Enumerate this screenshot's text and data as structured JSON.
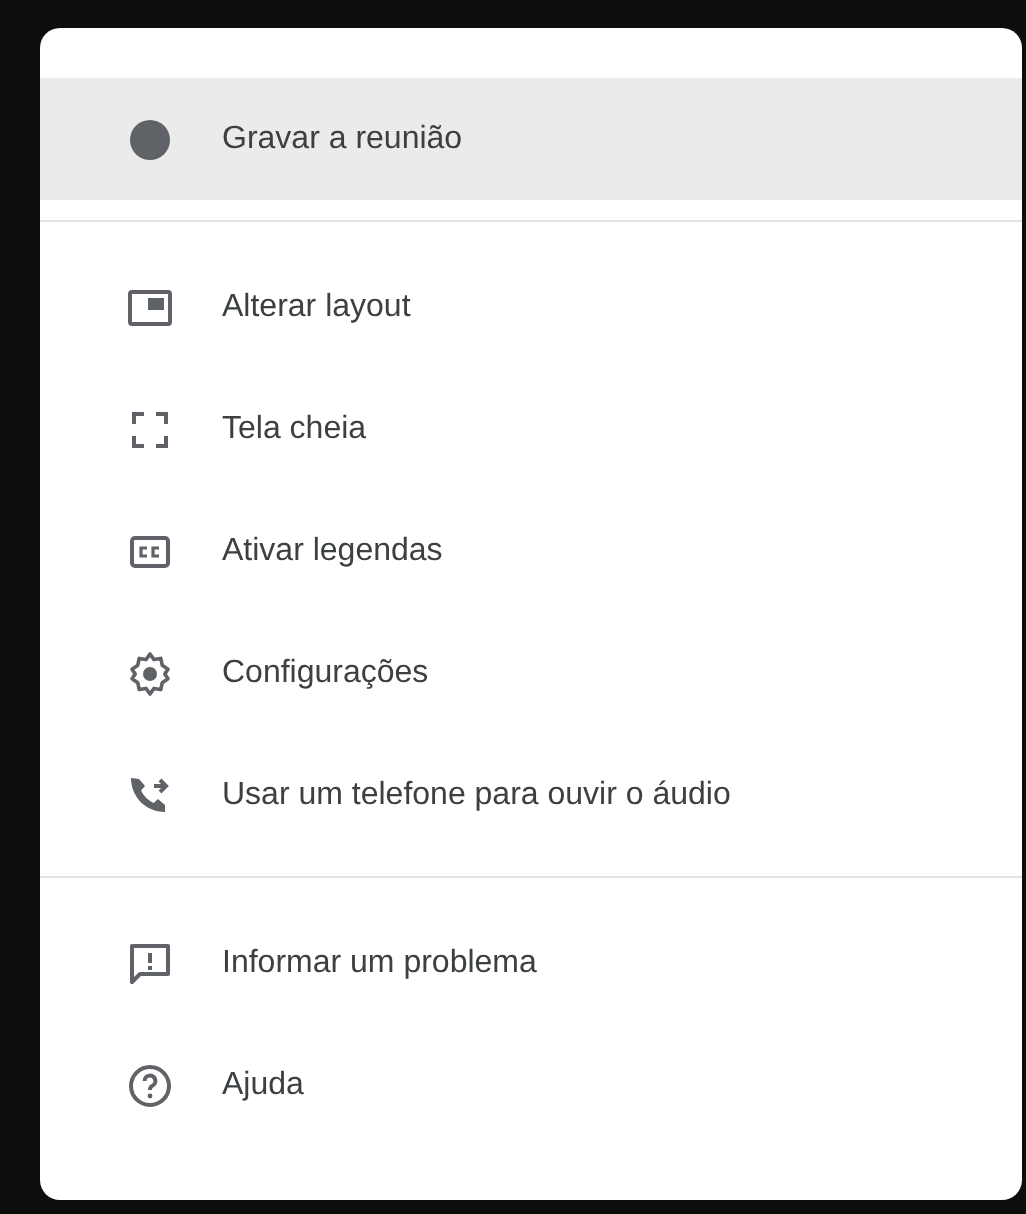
{
  "menu": {
    "sections": [
      {
        "items": [
          {
            "label": "Gravar a reunião",
            "kind": "record",
            "selected": true
          }
        ]
      },
      {
        "items": [
          {
            "label": "Alterar layout",
            "kind": "layout",
            "selected": false
          },
          {
            "label": "Tela cheia",
            "kind": "fullscreen",
            "selected": false
          },
          {
            "label": "Ativar legendas",
            "kind": "captions",
            "selected": false
          },
          {
            "label": "Configurações",
            "kind": "settings",
            "selected": false
          },
          {
            "label": "Usar um telefone para ouvir o áudio",
            "kind": "phone",
            "selected": false
          }
        ]
      },
      {
        "items": [
          {
            "label": "Informar um problema",
            "kind": "feedback",
            "selected": false
          },
          {
            "label": "Ajuda",
            "kind": "help",
            "selected": false
          }
        ]
      }
    ]
  }
}
